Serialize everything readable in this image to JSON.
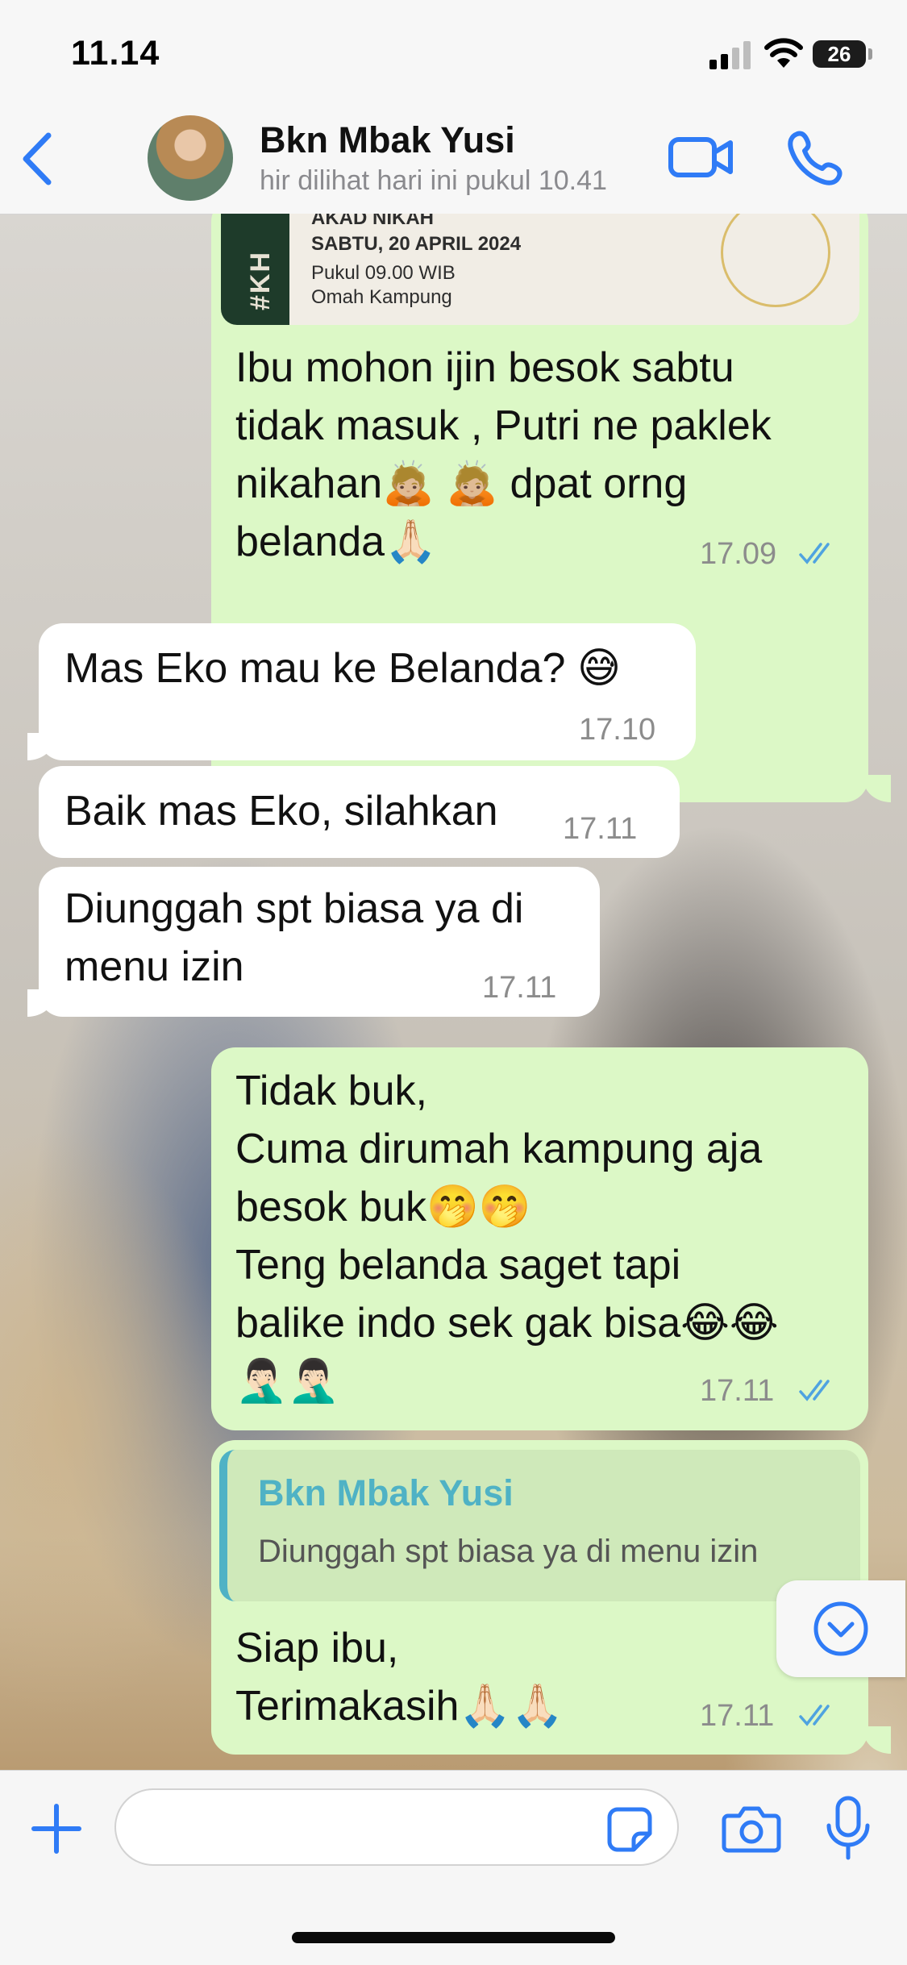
{
  "status_bar": {
    "time": "11.14",
    "battery": "26"
  },
  "header": {
    "contact_name": "Bkn Mbak Yusi",
    "last_seen": "hir dilihat hari ini pukul 10.41"
  },
  "image_card": {
    "lines": [
      "AKAD NIKAH",
      "SABTU, 20 APRIL 2024",
      "Pukul 09.00 WIB",
      "Omah Kampung"
    ],
    "vertical_text": "#KH"
  },
  "messages": [
    {
      "direction": "out",
      "lines": [
        "Ibu mohon ijin besok sabtu",
        "tidak masuk , Putri ne paklek",
        "nikahan🙇🏼 🙇🏼 dpat orng",
        "belanda🙏🏻"
      ],
      "time": "17.09",
      "status": "read"
    },
    {
      "direction": "in",
      "lines": [
        "Mas Eko mau ke Belanda? 😅"
      ],
      "time": "17.10"
    },
    {
      "direction": "in",
      "lines": [
        "Baik mas Eko, silahkan"
      ],
      "time": "17.11"
    },
    {
      "direction": "in",
      "lines": [
        "Diunggah spt biasa ya di",
        "menu izin"
      ],
      "time": "17.11"
    },
    {
      "direction": "out",
      "lines": [
        "Tidak buk,",
        "Cuma dirumah kampung aja",
        "besok buk🤭🤭",
        "Teng belanda saget tapi",
        "balike indo sek gak bisa😂😂",
        "🤦🏻‍♂️🤦🏻‍♂️"
      ],
      "time": "17.11",
      "status": "read"
    },
    {
      "direction": "out",
      "quote": {
        "name": "Bkn Mbak Yusi",
        "text": "Diunggah spt biasa ya di menu izin"
      },
      "lines": [
        "Siap ibu,",
        "Terimakasih🙏🏻🙏🏻"
      ],
      "time": "17.11",
      "status": "read"
    }
  ],
  "input": {
    "placeholder": ""
  },
  "colors": {
    "accent": "#2f7bf6",
    "outgoing_bubble": "#dcf8c6",
    "incoming_bubble": "#ffffff",
    "quote_name": "#4fb2c5",
    "read_ticks": "#4fa3e0"
  }
}
